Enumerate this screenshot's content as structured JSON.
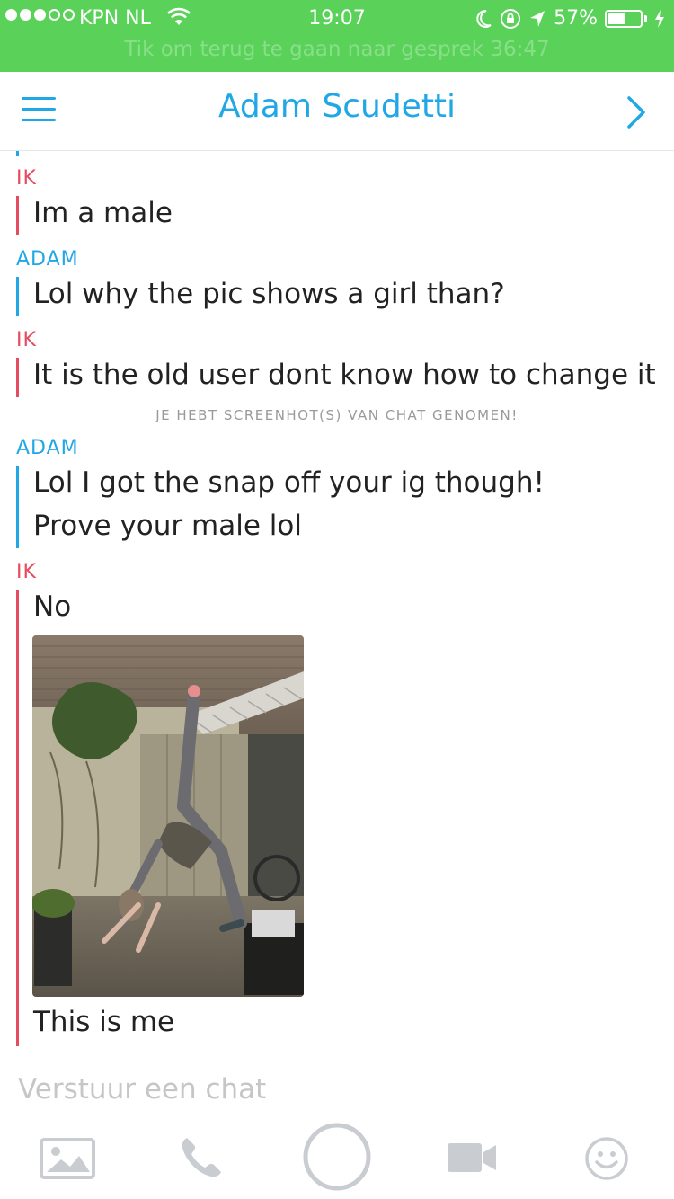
{
  "status_bar": {
    "carrier": "KPN NL",
    "time": "19:07",
    "battery": "57%",
    "battery_level": 0.57,
    "signal_bars_filled": 3,
    "signal_bars_total": 5
  },
  "call_banner": "Tik om terug te gaan naar gesprek 36:47",
  "header": {
    "title": "Adam Scudetti"
  },
  "messages": [
    {
      "sender": "IK",
      "text": "Im a male"
    },
    {
      "sender": "ADAM",
      "text": "Lol why the pic shows a girl than?"
    },
    {
      "sender": "IK",
      "text": "It is the old user dont know how to change it"
    },
    {
      "notice": "JE HEBT  SCREENHOT(S) VAN CHAT GENOMEN!"
    },
    {
      "sender": "ADAM",
      "lines": [
        "Lol I got the snap off your ig though!",
        "Prove your male lol"
      ]
    },
    {
      "sender": "IK",
      "lines": [
        "No",
        "This is me"
      ]
    }
  ],
  "composer": {
    "placeholder": "Verstuur een chat"
  },
  "toolbar": [
    "image-icon",
    "phone-icon",
    "capture-button",
    "video-icon",
    "emoji-icon"
  ],
  "colors": {
    "status_green": "#5ad25a",
    "accent_blue": "#1fa8e5",
    "me_red": "#e64b5f"
  }
}
